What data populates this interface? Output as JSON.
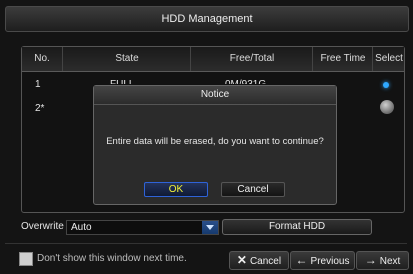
{
  "window": {
    "title": "HDD Management"
  },
  "table": {
    "columns": [
      "No.",
      "State",
      "Free/Total",
      "Free Time",
      "Select"
    ],
    "rows": [
      {
        "no": "1",
        "state": "FULL",
        "free_total": "0M/931G",
        "free_time": "",
        "selected": true
      },
      {
        "no": "2*",
        "state": "",
        "free_total": "",
        "free_time": "",
        "selected": false
      }
    ]
  },
  "dialog": {
    "title": "Notice",
    "message": "Entire data will be erased, do you want to continue?",
    "ok_label": "OK",
    "cancel_label": "Cancel"
  },
  "controls": {
    "overwrite_label": "Overwrite",
    "overwrite_value": "Auto",
    "format_label": "Format HDD"
  },
  "footer": {
    "dont_show_label": "Don't show this window next time.",
    "cancel_label": "Cancel",
    "previous_label": "Previous",
    "next_label": "Next"
  },
  "colors": {
    "accent": "#2fa8ff",
    "ok_text": "#f2f236"
  }
}
